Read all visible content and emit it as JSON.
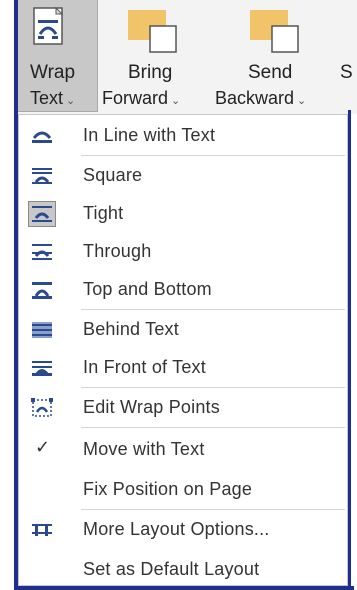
{
  "ribbon": {
    "wrap_text": {
      "line1": "Wrap",
      "line2": "Text"
    },
    "bring_forward": {
      "line1": "Bring",
      "line2": "Forward"
    },
    "send_backward": {
      "line1": "Send",
      "line2": "Backward"
    },
    "cut_label": "S"
  },
  "menu": {
    "items": [
      {
        "label": "In Line with Text",
        "icon": "inline-text-icon"
      },
      {
        "label": "Square",
        "icon": "square-wrap-icon"
      },
      {
        "label": "Tight",
        "icon": "tight-wrap-icon",
        "selected": true
      },
      {
        "label": "Through",
        "icon": "through-wrap-icon"
      },
      {
        "label": "Top and Bottom",
        "icon": "top-bottom-wrap-icon"
      },
      {
        "label": "Behind Text",
        "icon": "behind-text-icon"
      },
      {
        "label": "In Front of Text",
        "icon": "in-front-text-icon"
      },
      {
        "label": "Edit Wrap Points",
        "icon": "edit-wrap-points-icon"
      },
      {
        "label": "Move with Text",
        "icon": "checkmark-icon",
        "checked": true
      },
      {
        "label": "Fix Position on Page",
        "icon": ""
      },
      {
        "label": "More Layout Options...",
        "icon": "layout-options-icon"
      },
      {
        "label": "Set as Default Layout",
        "icon": ""
      }
    ]
  },
  "colors": {
    "frame": "#1d2f8f",
    "selected_bg": "#c8c8c8",
    "icon_blue": "#2b4a8c",
    "folder": "#f2c46a"
  }
}
